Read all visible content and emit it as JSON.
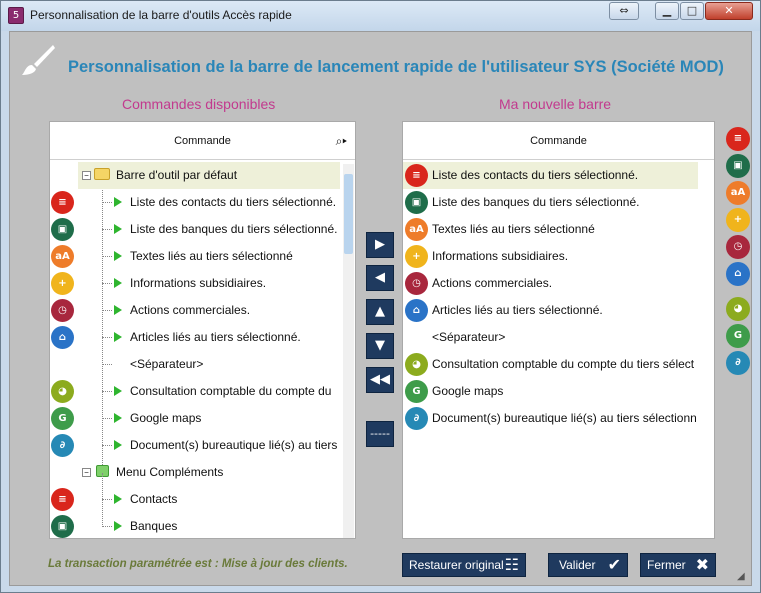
{
  "window": {
    "title": "Personnalisation de la barre d'outils Accès rapide"
  },
  "heading": "Personnalisation de la barre de lancement rapide de l'utilisateur SYS (Société  MOD)",
  "left": {
    "title": "Commandes disponibles",
    "column_header": "Commande",
    "group1": "Barre d'outil par défaut",
    "items": [
      {
        "label": "Liste des contacts du tiers sélectionné.",
        "icon": "contacts-icon",
        "color": "#d9261c",
        "glyph": "≡"
      },
      {
        "label": "Liste des banques du tiers sélectionné.",
        "icon": "bank-icon",
        "color": "#1f6d4a",
        "glyph": "▣"
      },
      {
        "label": "Textes liés au tiers sélectionné",
        "icon": "text-icon",
        "color": "#ee7c2a",
        "glyph": "aA"
      },
      {
        "label": "Informations subsidiaires.",
        "icon": "info-icon",
        "color": "#f0b41c",
        "glyph": "+"
      },
      {
        "label": "Actions commerciales.",
        "icon": "alarm-icon",
        "color": "#a8273d",
        "glyph": "◷"
      },
      {
        "label": "Articles liés au tiers sélectionné.",
        "icon": "basket-icon",
        "color": "#2a73c7",
        "glyph": "⌂"
      },
      {
        "label": "<Séparateur>",
        "icon": "",
        "color": "",
        "glyph": ""
      },
      {
        "label": "Consultation comptable du compte du",
        "icon": "accounting-icon",
        "color": "#8cab1e",
        "glyph": "◕"
      },
      {
        "label": "Google maps",
        "icon": "maps-icon",
        "color": "#3e9c4a",
        "glyph": "G"
      },
      {
        "label": "Document(s) bureautique lié(s) au tiers",
        "icon": "attachment-icon",
        "color": "#2689b5",
        "glyph": "∂"
      }
    ],
    "group2": "Menu Compléments",
    "items2": [
      {
        "label": "Contacts",
        "icon": "contacts-icon",
        "color": "#d9261c",
        "glyph": "≡"
      },
      {
        "label": "Banques",
        "icon": "bank-icon",
        "color": "#1f6d4a",
        "glyph": "▣"
      }
    ]
  },
  "right": {
    "title": "Ma nouvelle barre",
    "column_header": "Commande",
    "items": [
      {
        "label": "Liste des contacts du tiers sélectionné.",
        "icon": "contacts-icon",
        "color": "#d9261c",
        "glyph": "≡"
      },
      {
        "label": "Liste des banques du tiers sélectionné.",
        "icon": "bank-icon",
        "color": "#1f6d4a",
        "glyph": "▣"
      },
      {
        "label": "Textes liés au tiers sélectionné",
        "icon": "text-icon",
        "color": "#ee7c2a",
        "glyph": "aA"
      },
      {
        "label": "Informations subsidiaires.",
        "icon": "info-icon",
        "color": "#f0b41c",
        "glyph": "+"
      },
      {
        "label": "Actions commerciales.",
        "icon": "alarm-icon",
        "color": "#a8273d",
        "glyph": "◷"
      },
      {
        "label": "Articles liés au tiers sélectionné.",
        "icon": "basket-icon",
        "color": "#2a73c7",
        "glyph": "⌂"
      },
      {
        "label": "<Séparateur>",
        "icon": "",
        "color": "",
        "glyph": ""
      },
      {
        "label": "Consultation comptable du compte du tiers sélect",
        "icon": "accounting-icon",
        "color": "#8cab1e",
        "glyph": "◕"
      },
      {
        "label": "Google maps",
        "icon": "maps-icon",
        "color": "#3e9c4a",
        "glyph": "G"
      },
      {
        "label": "Document(s) bureautique lié(s) au tiers sélectionn",
        "icon": "attachment-icon",
        "color": "#2689b5",
        "glyph": "∂"
      }
    ]
  },
  "nav": {
    "separator_label": "-----"
  },
  "status": "La transaction paramétrée est :  Mise à jour des clients.",
  "buttons": {
    "restore": "Restaurer original",
    "validate": "Valider",
    "close": "Fermer"
  }
}
